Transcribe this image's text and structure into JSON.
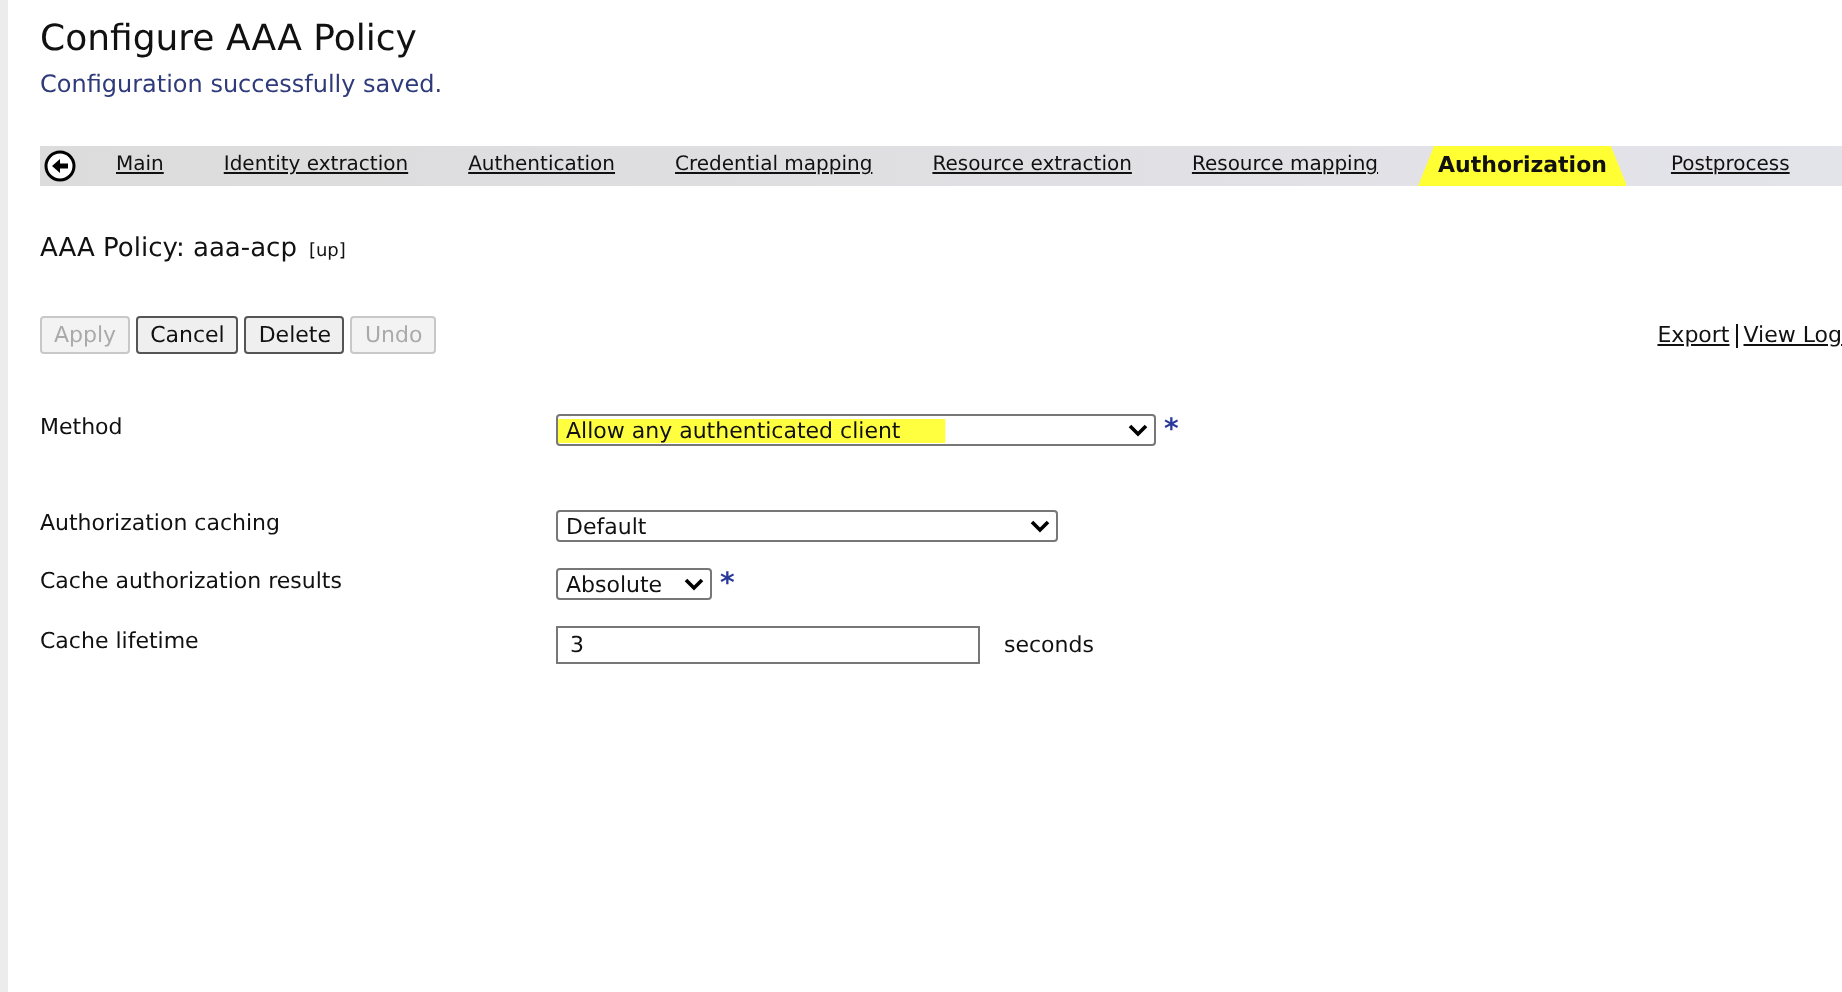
{
  "page": {
    "title": "Configure AAA Policy",
    "message": "Configuration successfully saved."
  },
  "tabs": [
    {
      "label": "Main",
      "selected": false
    },
    {
      "label": "Identity extraction",
      "selected": false
    },
    {
      "label": "Authentication",
      "selected": false
    },
    {
      "label": "Credential mapping",
      "selected": false
    },
    {
      "label": "Resource extraction",
      "selected": false
    },
    {
      "label": "Resource mapping",
      "selected": false
    },
    {
      "label": "Authorization",
      "selected": true
    },
    {
      "label": "Postprocess",
      "selected": false
    }
  ],
  "object": {
    "label": "AAA Policy: aaa-acp",
    "status": "[up]"
  },
  "buttons": [
    {
      "label": "Apply",
      "disabled": true
    },
    {
      "label": "Cancel",
      "disabled": false
    },
    {
      "label": "Delete",
      "disabled": false
    },
    {
      "label": "Undo",
      "disabled": true
    }
  ],
  "links": [
    "Export",
    "View Log"
  ],
  "fields": [
    {
      "kind": "select",
      "label": "Method",
      "value": "Allow any authenticated client",
      "required_mark": "*",
      "highlighted": true
    },
    {
      "kind": "select",
      "label": "Authorization caching",
      "value": "Default",
      "highlighted": false
    },
    {
      "kind": "select",
      "label": "Cache authorization results",
      "value": "Absolute",
      "required_mark": "*",
      "highlighted": false
    },
    {
      "kind": "input",
      "label": "Cache lifetime",
      "value": "3",
      "unit": "seconds",
      "highlighted": false
    }
  ]
}
